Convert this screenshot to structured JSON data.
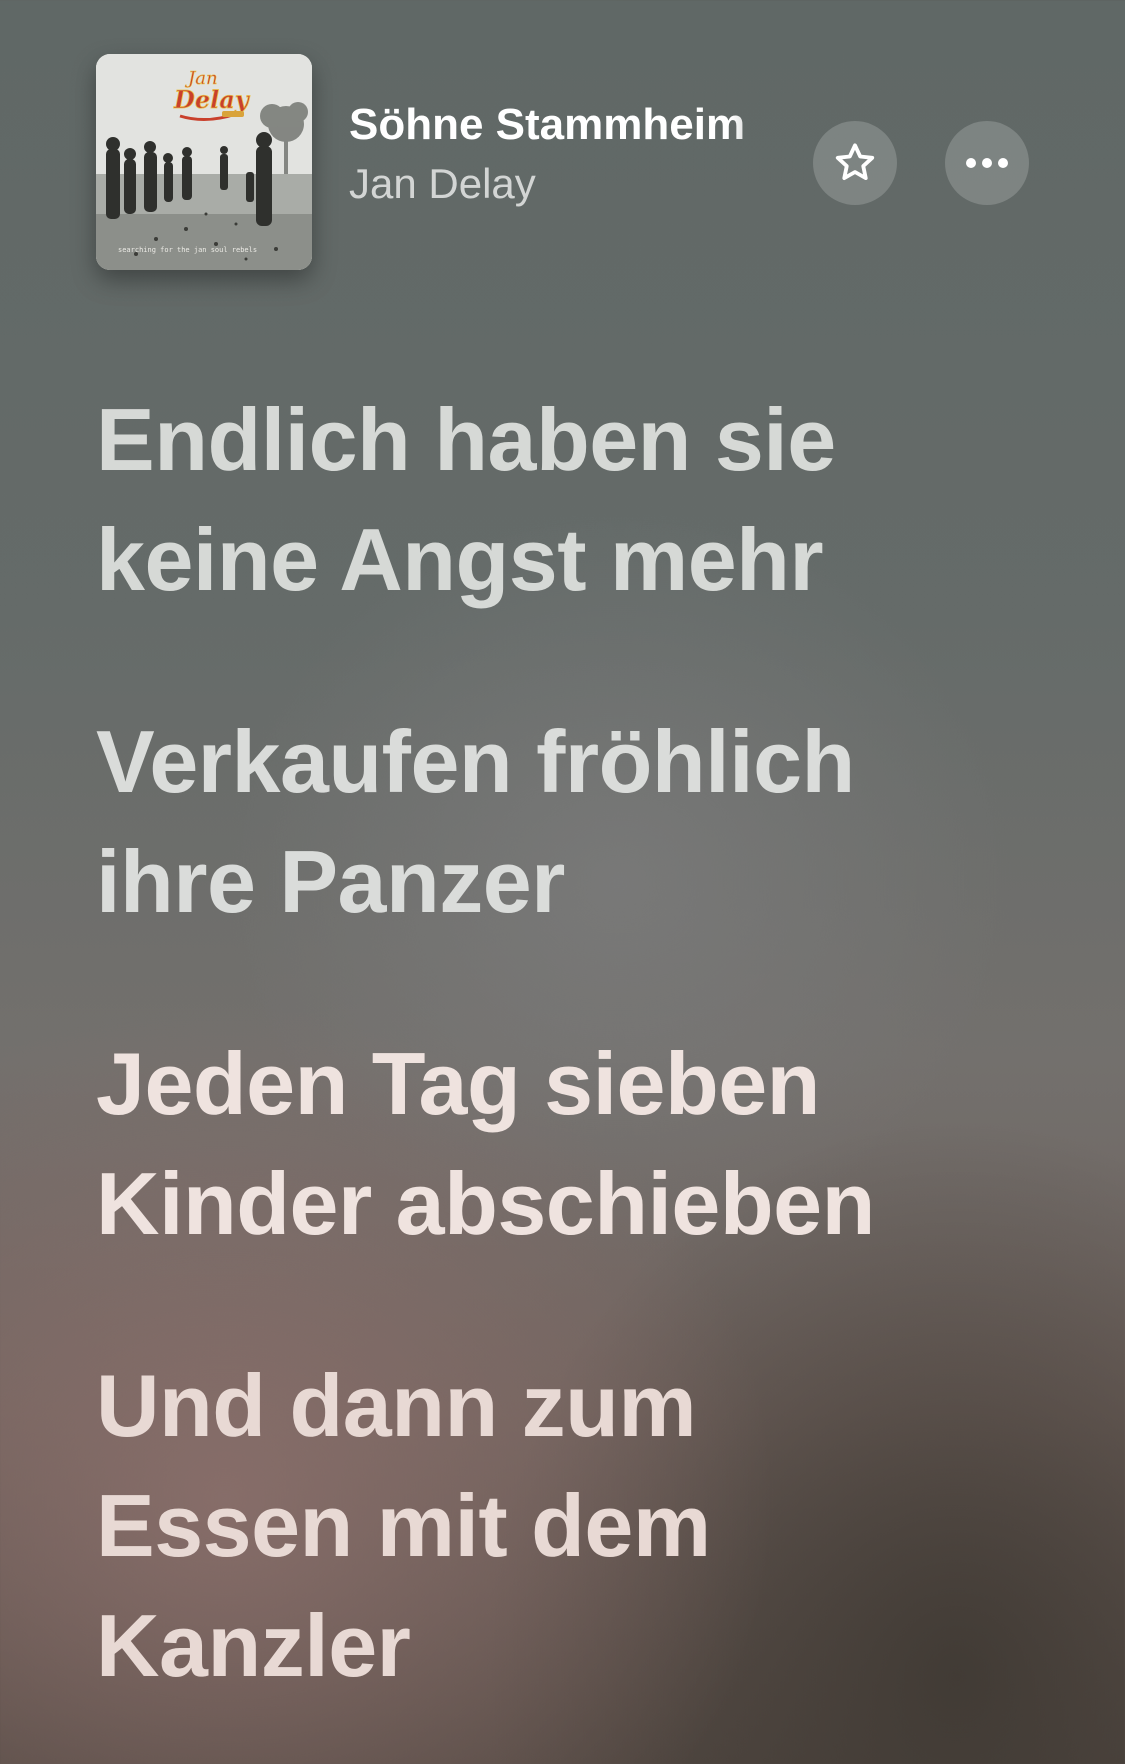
{
  "now_playing": {
    "title": "Söhne Stammheim",
    "artist": "Jan Delay",
    "cover": {
      "logo_text": "Jan Delay",
      "tagline": "searching for the jan soul rebels"
    }
  },
  "actions": {
    "favorite_icon": "star-icon",
    "more_icon": "ellipsis-icon"
  },
  "lyrics": [
    {
      "lines": [
        "Endlich haben sie",
        "keine Angst mehr"
      ],
      "color": "#d6d9d6"
    },
    {
      "lines": [
        "Verkaufen fröhlich",
        "ihre Panzer"
      ],
      "color": "#dadcda"
    },
    {
      "lines": [
        "Jeden Tag sieben",
        "Kinder abschieben"
      ],
      "color": "#efe3df"
    },
    {
      "lines": [
        "Und dann zum",
        "Essen mit dem",
        "Kanzler"
      ],
      "color": "#e8d9d4"
    }
  ]
}
